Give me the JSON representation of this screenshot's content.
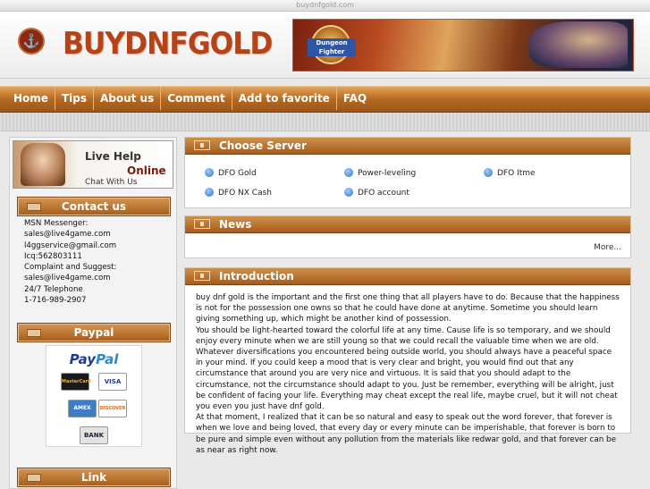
{
  "browser": {
    "url_text": "buydnfgold.com"
  },
  "header": {
    "logo_text": "BUYDNFGOLD",
    "banner_text": "Dungeon Fighter"
  },
  "nav": [
    "Home",
    "Tips",
    "About us",
    "Comment",
    "Add to favorite",
    "FAQ"
  ],
  "sidebar": {
    "live_help": {
      "line1": "Live Help",
      "line2": "Online",
      "line3": "Chat With Us"
    },
    "contact_title": "Contact us",
    "contact_lines": [
      "MSN Messenger:",
      "sales@live4game.com",
      "l4ggservice@gmail.com",
      "Icq:562803111",
      "Complaint and Suggest:",
      "sales@live4game.com",
      "24/7 Telephone",
      "1-716-989-2907"
    ],
    "paypal_title": "Paypal",
    "paypal_logo": {
      "pay": "Pay",
      "pal": "Pal"
    },
    "cards": [
      "MasterCard",
      "VISA",
      "AMEX",
      "DISCOVER",
      "BANK"
    ],
    "link_title": "Link"
  },
  "choose_server": {
    "title": "Choose Server",
    "items": [
      "DFO Gold",
      "Power-leveling",
      "DFO Itme",
      "DFO NX Cash",
      "DFO account"
    ]
  },
  "news": {
    "title": "News",
    "more": "More..."
  },
  "introduction": {
    "title": "Introduction",
    "paragraphs": [
      "buy dnf gold is the important and the first one thing that all players have to do. Because that the happiness is not for the possession one owns so that he could have done at anytime. Sometime you should learn giving something up, which might be another kind of possession.",
      "You should be light-hearted toward the colorful life at any time. Cause life is so temporary, and we should enjoy every minute when we are still young so that we could recall the valuable time when we are old. Whatever diversifications you encountered being outside world, you should always have a peaceful space in your mind. If you could keep a mood that is very clear and bright, you would find out that any circumstance that around you are very nice and virtuous. It is said that you should adapt to the circumstance, not the circumstance should adapt to you. Just be remember, everything will be alright, just be confident of facing your life. Everything may cheat except the real life, maybe cruel, but it will not cheat you even you just have dnf gold.",
      "At that moment, I realized that it can be so natural and easy to speak out the word forever, that forever is when we love and being loved, that every day or every minute can be imperishable, that forever is born to be pure and simple even without any pollution from the materials like redwar gold, and that forever can be as near as right now."
    ]
  }
}
